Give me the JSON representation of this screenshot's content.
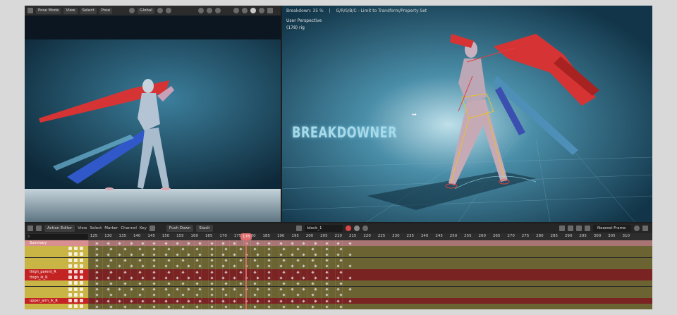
{
  "left_viewport": {
    "header": {
      "mode": "Pose Mode",
      "menus": [
        "View",
        "Select",
        "Pose"
      ],
      "transform_orientation": "Global"
    }
  },
  "right_viewport": {
    "status": {
      "breakdown": "Breakdown: 35 %",
      "hints": "G/R/S/B/C - Limit to Transform/Property Set"
    },
    "view_label": "User Perspective",
    "frame_label": "(178) rig",
    "overlay_title": "BREAKDOWNER"
  },
  "action_editor": {
    "mode": "Action Editor",
    "menus": [
      "View",
      "Select",
      "Marker",
      "Channel",
      "Key"
    ],
    "push_down": "Push Down",
    "stash": "Stash",
    "action_name": "block_1",
    "snapping": "Nearest Frame",
    "current_frame": "178",
    "ticks": [
      "125",
      "130",
      "135",
      "140",
      "145",
      "150",
      "155",
      "160",
      "165",
      "170",
      "175",
      "180",
      "185",
      "190",
      "195",
      "200",
      "205",
      "210",
      "215",
      "220",
      "225",
      "230",
      "235",
      "240",
      "245",
      "250",
      "255",
      "260",
      "265",
      "270",
      "275",
      "280",
      "285",
      "290",
      "295",
      "300",
      "305",
      "310"
    ],
    "channels": [
      {
        "name": "Summary",
        "type": "summary"
      },
      {
        "name": "",
        "type": "yellow"
      },
      {
        "name": "",
        "type": "yellow"
      },
      {
        "name": "",
        "type": "yellow"
      },
      {
        "name": "",
        "type": "yellow"
      },
      {
        "name": "thigh_parent_R",
        "type": "red"
      },
      {
        "name": "thigh_ik_R",
        "type": "red"
      },
      {
        "name": "",
        "type": "yellow"
      },
      {
        "name": "",
        "type": "yellow"
      },
      {
        "name": "",
        "type": "yellow"
      },
      {
        "name": "upper_arm_ik_R",
        "type": "red"
      },
      {
        "name": "",
        "type": "yellow"
      }
    ]
  },
  "colors": {
    "summary_row": "#d98f8f",
    "yellow_row": "#6b6432",
    "yellow_name": "#c9b545",
    "red_row": "#7a2323",
    "red_name": "#c42323",
    "playhead": "#e06e6e"
  }
}
